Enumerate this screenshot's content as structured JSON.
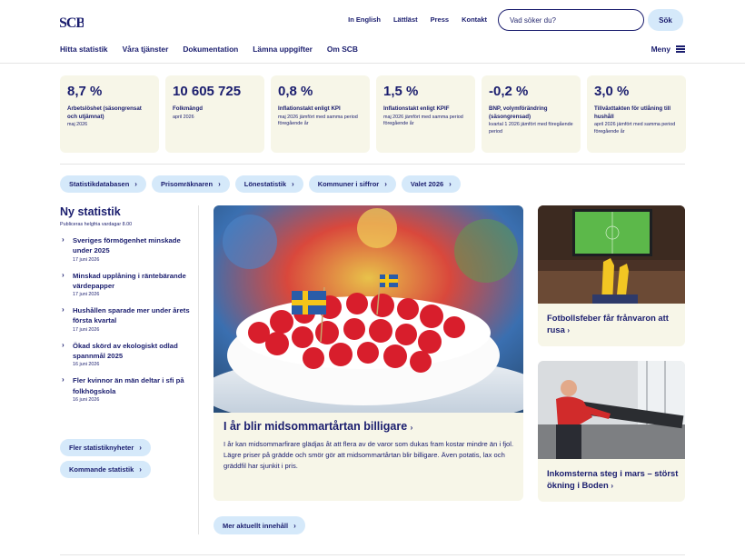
{
  "header": {
    "logo_text": "SCB",
    "top_links": [
      "In English",
      "Lättläst",
      "Press",
      "Kontakt"
    ],
    "search_placeholder": "Vad söker du?",
    "search_button": "Sök",
    "nav": [
      "Hitta statistik",
      "Våra tjänster",
      "Dokumentation",
      "Lämna uppgifter",
      "Om SCB"
    ],
    "menu_label": "Meny"
  },
  "kpis": [
    {
      "value": "8,7 %",
      "label": "Arbetslöshet (säsongrensat och utjämnat)",
      "sub": "maj 2026"
    },
    {
      "value": "10 605 725",
      "label": "Folkmängd",
      "sub": "april 2026"
    },
    {
      "value": "0,8 %",
      "label": "Inflationstakt enligt KPI",
      "sub": "maj 2026 jämfört med samma period föregående år"
    },
    {
      "value": "1,5 %",
      "label": "Inflationstakt enligt KPIF",
      "sub": "maj 2026 jämfört med samma period föregående år"
    },
    {
      "value": "-0,2 %",
      "label": "BNP, volymförändring (säsongrensad)",
      "sub": "kvartal 1 2026 jämfört med föregående period"
    },
    {
      "value": "3,0 %",
      "label": "Tillväxttakten för utlåning till hushåll",
      "sub": "april 2026 jämfört med samma period föregående år"
    }
  ],
  "quick_links": [
    "Statistikdatabasen",
    "Prisomräknaren",
    "Lönestatistik",
    "Kommuner i siffror",
    "Valet 2026"
  ],
  "news": {
    "title": "Ny statistik",
    "subtitle": "Publiceras helgfria vardagar 8.00",
    "items": [
      {
        "title": "Sveriges förmögenhet minskade under 2025",
        "date": "17 juni 2026"
      },
      {
        "title": "Minskad upplåning i räntebärande värdepapper",
        "date": "17 juni 2026"
      },
      {
        "title": "Hushållen sparade mer under årets första kvartal",
        "date": "17 juni 2026"
      },
      {
        "title": "Ökad skörd av ekologiskt odlad spannmål 2025",
        "date": "16 juni 2026"
      },
      {
        "title": "Fler kvinnor än män deltar i sfi på folkhögskola",
        "date": "16 juni 2026"
      }
    ],
    "more_news": "Fler statistiknyheter",
    "upcoming": "Kommande statistik"
  },
  "feature": {
    "title": "I år blir midsommartårtan billigare",
    "text": "I år kan midsommarfirare glädjas åt att flera av de varor som dukas fram kostar mindre än i fjol. Lägre priser på grädde och smör gör att midsommartårtan blir billigare. Även potatis, lax och gräddfil har sjunkit i pris."
  },
  "side_articles": [
    {
      "title": "Fotbollsfeber får frånvaron att rusa"
    },
    {
      "title": "Inkomsterna steg i mars – störst ökning i Boden"
    }
  ],
  "more_content": "Mer aktuellt innehåll",
  "icons": {
    "chevron": "›",
    "arrow": "›"
  },
  "colors": {
    "brand": "#1a1d6e",
    "pill": "#d5e9fa",
    "card": "#f7f6e8"
  }
}
